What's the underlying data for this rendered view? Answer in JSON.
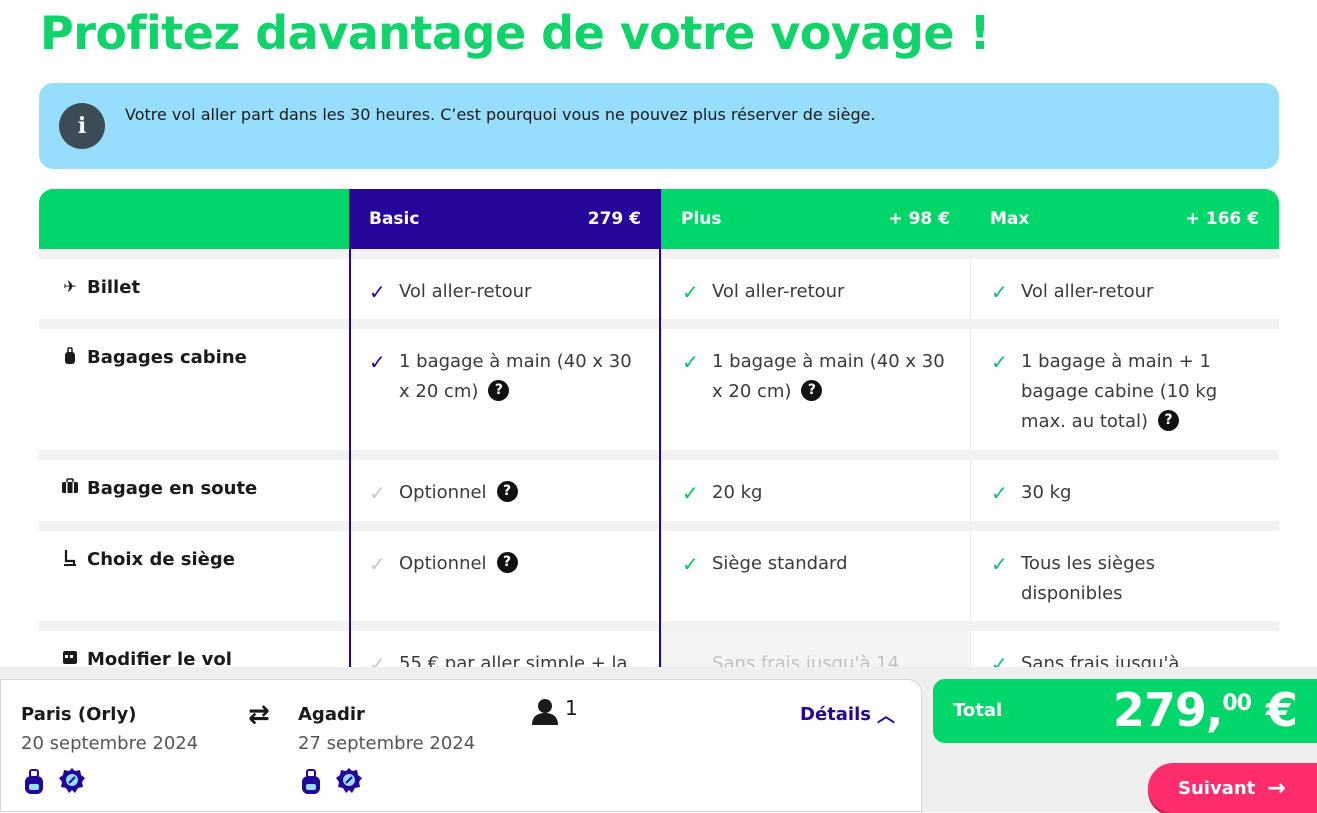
{
  "title": "Profitez davantage de votre voyage !",
  "info": {
    "icon": "info-icon",
    "icon_glyph": "i",
    "text": "Votre vol aller part dans les 30 heures. C’est pourquoi vous ne pouvez plus réserver de siège."
  },
  "plans": [
    {
      "name": "Basic",
      "price": "279 €"
    },
    {
      "name": "Plus",
      "price": "+ 98 €"
    },
    {
      "name": "Max",
      "price": "+ 166 €"
    }
  ],
  "rows": [
    {
      "label": "Billet",
      "icon": "plane-icon",
      "basic": "Vol aller-retour",
      "plus": "Vol aller-retour",
      "max": "Vol aller-retour"
    },
    {
      "label": "Bagages cabine",
      "icon": "backpack-icon",
      "basic": "1 bagage à main (40 x 30 x 20 cm)",
      "plus": "1 bagage à main (40 x 30 x 20 cm)",
      "max": "1 bagage à main + 1 bagage cabine (10 kg max. au total)"
    },
    {
      "label": "Bagage en soute",
      "icon": "suitcase-icon",
      "basic": "Optionnel",
      "plus": "20 kg",
      "max": "30 kg"
    },
    {
      "label": "Choix de siège",
      "icon": "seat-icon",
      "basic": "Optionnel",
      "plus": "Siège standard",
      "max": "Tous les sièges disponibles"
    },
    {
      "label": "Modifier le vol",
      "icon": "calendar-edit-icon",
      "basic": "55 € par aller simple + la",
      "plus": "Sans frais jusqu'à 14",
      "max": "Sans frais jusqu'à"
    }
  ],
  "trip": {
    "from_city": "Paris (Orly)",
    "from_date": "20 septembre 2024",
    "to_city": "Agadir",
    "to_date": "27 septembre 2024",
    "passengers": "1",
    "details_label": "Détails"
  },
  "total": {
    "label": "Total",
    "amount_main": "279,",
    "amount_cents": "00",
    "currency": "€"
  },
  "next_label": "Suivant",
  "colors": {
    "green": "#00d66a",
    "purple": "#25059a",
    "banner": "#97defc",
    "cta": "#ff2d6c"
  }
}
